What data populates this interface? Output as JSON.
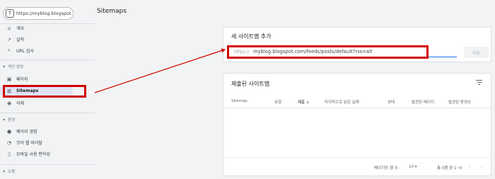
{
  "property": {
    "badge": "T",
    "url": "https://myblog.blogspot"
  },
  "page_title": "Sitemaps",
  "nav": {
    "overview": "개요",
    "performance": "실적",
    "url_inspection": "URL 검사",
    "index_section": "색인 생성",
    "pages": "페이지",
    "sitemaps": "Sitemaps",
    "removals": "삭제",
    "experience_section": "환경",
    "page_experience": "페이지 경험",
    "core_web_vitals": "코어 웹 바이탈",
    "mobile_usability": "모바일 사용 편의성",
    "shopping_section": "쇼핑"
  },
  "add_sitemap": {
    "title": "새 사이트맵 추가",
    "prefix": "https://",
    "path": "myblog.blogspot.com/feeds/posts/default?rss=alt",
    "submit_label": "제출"
  },
  "submitted": {
    "title": "제출된 사이트맵",
    "columns": [
      "Sitemap",
      "유형",
      "제출 ↓",
      "마지막으로 읽은 날짜",
      "상태",
      "발견된 페이지",
      "발견된 동영상"
    ],
    "rows_per_page_label": "페이지당 행 수:",
    "rows_per_page_value": "10",
    "range": "총 0행 중 1~0"
  },
  "colors": {
    "accent": "#1a73e8",
    "highlight": "#d10000",
    "active_bg": "#dfe3f5"
  }
}
